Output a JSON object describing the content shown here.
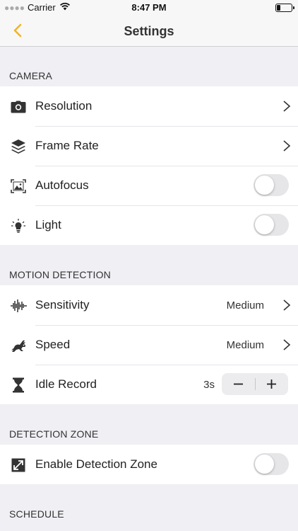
{
  "status_bar": {
    "carrier": "Carrier",
    "time": "8:47 PM"
  },
  "nav": {
    "title": "Settings",
    "back_icon": "chevron-left-icon",
    "accent": "#f0b429"
  },
  "sections": {
    "camera": {
      "header": "CAMERA",
      "items": [
        {
          "label": "Resolution",
          "icon": "camera-icon",
          "control": "chevron"
        },
        {
          "label": "Frame Rate",
          "icon": "layers-icon",
          "control": "chevron"
        },
        {
          "label": "Autofocus",
          "icon": "focus-frame-icon",
          "control": "toggle",
          "on": false
        },
        {
          "label": "Light",
          "icon": "lightbulb-icon",
          "control": "toggle",
          "on": false
        }
      ]
    },
    "motion": {
      "header": "MOTION DETECTION",
      "items": [
        {
          "label": "Sensitivity",
          "icon": "waveform-icon",
          "control": "chevron",
          "value": "Medium"
        },
        {
          "label": "Speed",
          "icon": "rabbit-icon",
          "control": "chevron",
          "value": "Medium"
        },
        {
          "label": "Idle Record",
          "icon": "hourglass-icon",
          "control": "stepper",
          "value": "3s"
        }
      ]
    },
    "zone": {
      "header": "DETECTION ZONE",
      "items": [
        {
          "label": "Enable Detection Zone",
          "icon": "expand-arrows-icon",
          "control": "toggle",
          "on": false
        }
      ]
    },
    "schedule": {
      "header": "SCHEDULE"
    }
  }
}
